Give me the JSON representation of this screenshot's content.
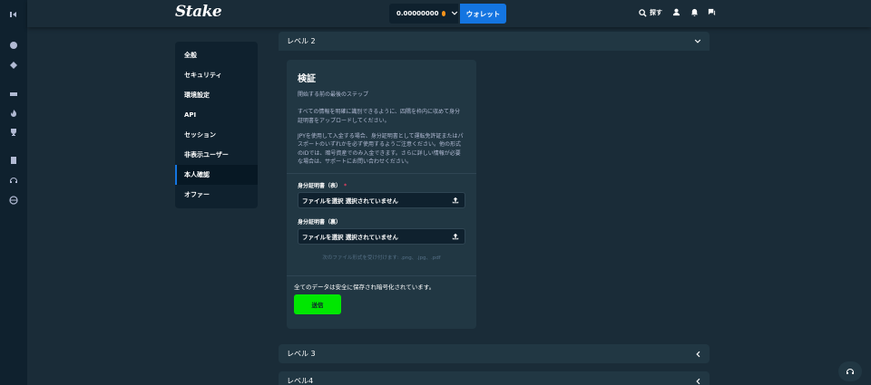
{
  "header": {
    "logo": "Stake",
    "balance": "0.00000000",
    "wallet_label": "ウォレット",
    "search_label": "探す"
  },
  "nav": {
    "items": [
      {
        "label": "全般"
      },
      {
        "label": "セキュリティ"
      },
      {
        "label": "環境設定"
      },
      {
        "label": "API"
      },
      {
        "label": "セッション"
      },
      {
        "label": "非表示ユーザー"
      },
      {
        "label": "本人確認",
        "active": true
      },
      {
        "label": "オファー"
      }
    ]
  },
  "panel": {
    "level2_title": "レベル 2",
    "card": {
      "title": "検証",
      "subtitle": "開始する前の最後のステップ",
      "para1": "すべての情報を明確に識別できるように、四隅を枠内に収めて身分証明書をアップロードしてください。",
      "para2": "JPYを使用して入金する場合、身分証明書として運転免許証またはパスポートのいずれかを必ず使用するようご注意ください。他の形式のIDでは、暗号資産でのみ入金できます。さらに詳しい情報が必要な場合は、サポートにお問い合わせください。",
      "front_label": "身分証明書（表）",
      "required_mark": "*",
      "front_file_text": "ファイルを選択 選択されていません",
      "back_label": "身分証明書（裏）",
      "back_file_text": "ファイルを選択 選択されていません",
      "formats_note": "次のファイル形式を受け付けます: .png、.jpg、.pdf",
      "secure_note": "全てのデータは安全に保存され暗号化されています。",
      "submit_label": "送信"
    }
  },
  "levels": {
    "level3_title": "レベル 3",
    "level4_title": "レベル4"
  },
  "colors": {
    "accent": "#1475e1",
    "submit": "#00e701",
    "required": "#ed4163"
  }
}
